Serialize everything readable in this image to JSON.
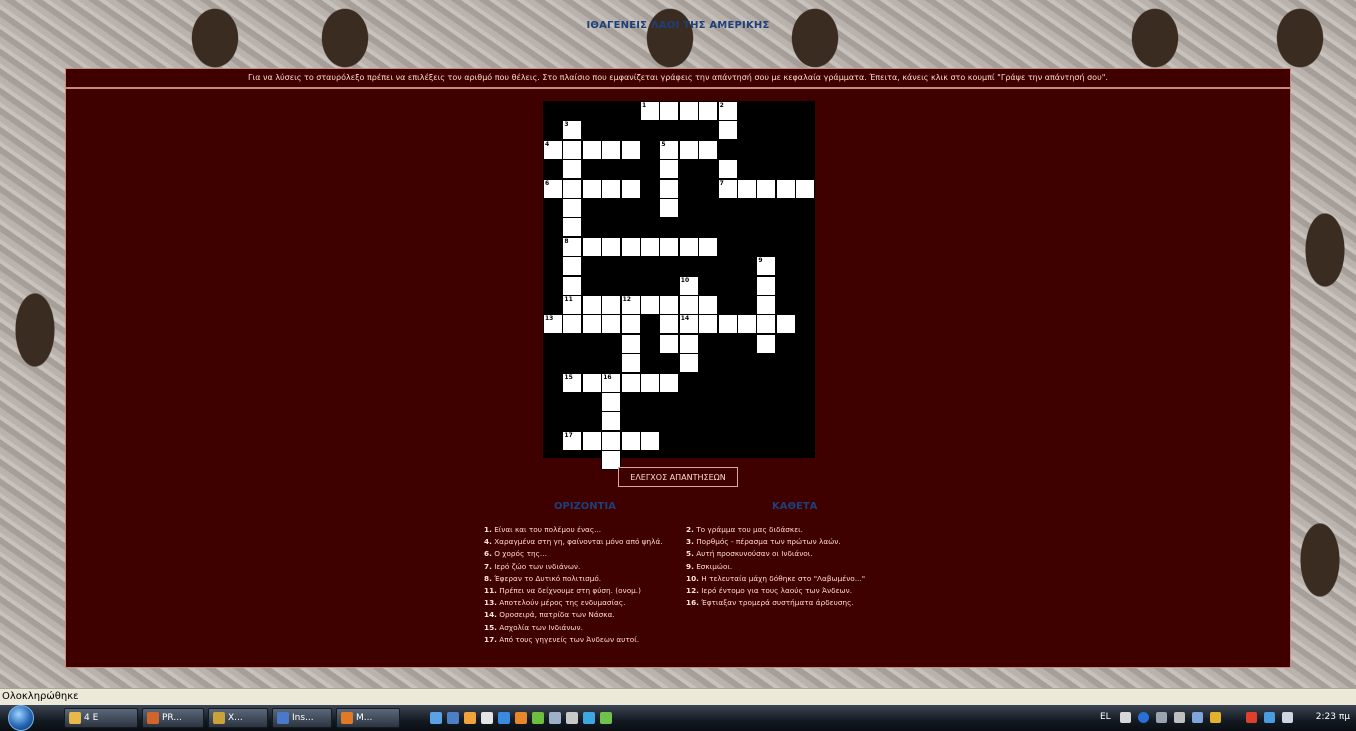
{
  "page": {
    "heading": "ΙΘΑΓΕΝΕΙΣ ΛΑΟΙ ΤΗΣ ΑΜΕΡΙΚΗΣ",
    "instructions": "Για να λύσεις το σταυρόλεξο πρέπει να επιλέξεις τον αριθμό που θέλεις. Στο πλαίσιο που εμφανίζεται γράφεις την απάντησή σου με κεφαλαία γράμματα. Έπειτα, κάνεις κλικ στο κουμπί \"Γράψε την απάντησή σου\".",
    "check_button": "ΕΛΕΓΧΟΣ ΑΠΑΝΤΗΣΕΩΝ"
  },
  "crossword": {
    "cells": [
      [
        5,
        0,
        1
      ],
      [
        6,
        0,
        null
      ],
      [
        7,
        0,
        null
      ],
      [
        8,
        0,
        null
      ],
      [
        9,
        0,
        2
      ],
      [
        1,
        1,
        3
      ],
      [
        9,
        1,
        null
      ],
      [
        0,
        2,
        4
      ],
      [
        1,
        2,
        null
      ],
      [
        2,
        2,
        null
      ],
      [
        3,
        2,
        null
      ],
      [
        4,
        2,
        null
      ],
      [
        6,
        2,
        5
      ],
      [
        7,
        2,
        null
      ],
      [
        8,
        2,
        null
      ],
      [
        1,
        3,
        null
      ],
      [
        6,
        3,
        null
      ],
      [
        9,
        3,
        null
      ],
      [
        0,
        4,
        6
      ],
      [
        1,
        4,
        null
      ],
      [
        2,
        4,
        null
      ],
      [
        3,
        4,
        null
      ],
      [
        4,
        4,
        null
      ],
      [
        6,
        4,
        null
      ],
      [
        9,
        4,
        7
      ],
      [
        10,
        4,
        null
      ],
      [
        11,
        4,
        null
      ],
      [
        12,
        4,
        null
      ],
      [
        13,
        4,
        null
      ],
      [
        1,
        5,
        null
      ],
      [
        6,
        5,
        null
      ],
      [
        1,
        6,
        null
      ],
      [
        1,
        7,
        8
      ],
      [
        2,
        7,
        null
      ],
      [
        3,
        7,
        null
      ],
      [
        4,
        7,
        null
      ],
      [
        5,
        7,
        null
      ],
      [
        6,
        7,
        null
      ],
      [
        7,
        7,
        null
      ],
      [
        8,
        7,
        null
      ],
      [
        1,
        8,
        null
      ],
      [
        11,
        8,
        9
      ],
      [
        1,
        9,
        null
      ],
      [
        7,
        9,
        10
      ],
      [
        11,
        9,
        null
      ],
      [
        1,
        10,
        11
      ],
      [
        2,
        10,
        null
      ],
      [
        3,
        10,
        null
      ],
      [
        4,
        10,
        12
      ],
      [
        5,
        10,
        null
      ],
      [
        6,
        10,
        null
      ],
      [
        7,
        10,
        null
      ],
      [
        8,
        10,
        null
      ],
      [
        11,
        10,
        null
      ],
      [
        0,
        11,
        13
      ],
      [
        1,
        11,
        null
      ],
      [
        2,
        11,
        null
      ],
      [
        3,
        11,
        null
      ],
      [
        4,
        11,
        null
      ],
      [
        6,
        11,
        null
      ],
      [
        7,
        11,
        14
      ],
      [
        8,
        11,
        null
      ],
      [
        9,
        11,
        null
      ],
      [
        10,
        11,
        null
      ],
      [
        11,
        11,
        null
      ],
      [
        12,
        11,
        null
      ],
      [
        4,
        12,
        null
      ],
      [
        6,
        12,
        null
      ],
      [
        7,
        12,
        null
      ],
      [
        11,
        12,
        null
      ],
      [
        4,
        13,
        null
      ],
      [
        7,
        13,
        null
      ],
      [
        1,
        14,
        15
      ],
      [
        2,
        14,
        null
      ],
      [
        3,
        14,
        16
      ],
      [
        4,
        14,
        null
      ],
      [
        5,
        14,
        null
      ],
      [
        6,
        14,
        null
      ],
      [
        3,
        15,
        null
      ],
      [
        3,
        16,
        null
      ],
      [
        1,
        17,
        17
      ],
      [
        2,
        17,
        null
      ],
      [
        3,
        17,
        null
      ],
      [
        4,
        17,
        null
      ],
      [
        5,
        17,
        null
      ],
      [
        3,
        18,
        null
      ]
    ]
  },
  "clues": {
    "across_title": "ΟΡΙΖΟΝΤΙΑ",
    "down_title": "ΚΑΘΕΤΑ",
    "across": [
      {
        "num": "1.",
        "text": "Είναι και του πολέμου ένας..."
      },
      {
        "num": "4.",
        "text": "Χαραγμένα στη γη, φαίνονται μόνο από ψηλά."
      },
      {
        "num": "6.",
        "text": "Ο χορός της..."
      },
      {
        "num": "7.",
        "text": "Ιερό ζώο των ινδιάνων."
      },
      {
        "num": "8.",
        "text": "Έφεραν το Δυτικό πολιτισμό."
      },
      {
        "num": "11.",
        "text": "Πρέπει να δείχνουμε στη φύση. (ονομ.)"
      },
      {
        "num": "13.",
        "text": "Αποτελούν μέρος της ενδυμασίας."
      },
      {
        "num": "14.",
        "text": "Οροσειρά, πατρίδα των Νάσκα."
      },
      {
        "num": "15.",
        "text": "Ασχολία των Ινδιάνων."
      },
      {
        "num": "17.",
        "text": "Από τους γηγενείς των Άνδεων αυτοί."
      }
    ],
    "down": [
      {
        "num": "2.",
        "text": "Το γράμμα του μας διδάσκει."
      },
      {
        "num": "3.",
        "text": "Πορθμός - πέρασμα των πρώτων λαών."
      },
      {
        "num": "5.",
        "text": "Αυτή προσκυνούσαν οι Ινδιάνοι."
      },
      {
        "num": "9.",
        "text": "Εσκιμώοι."
      },
      {
        "num": "10.",
        "text": "Η τελευταία μάχη δόθηκε στο \"Λαβωμένο...\""
      },
      {
        "num": "12.",
        "text": "Ιερό έντομο για τους λαούς των Άνδεων."
      },
      {
        "num": "16.",
        "text": "Έφτιαξαν τρομερά συστήματα άρδευσης."
      }
    ]
  },
  "status_bar": {
    "text": "Ολοκληρώθηκε"
  },
  "taskbar": {
    "buttons": [
      {
        "label": "4 E",
        "name": "explorer-group",
        "color": "#e8b84a"
      },
      {
        "label": "PR...",
        "name": "powerpoint",
        "color": "#d2652b"
      },
      {
        "label": "X...",
        "name": "app-x",
        "color": "#c9a33a"
      },
      {
        "label": "Ins...",
        "name": "instructions-app",
        "color": "#4a79c9"
      },
      {
        "label": "M...",
        "name": "firefox-window",
        "color": "#e07a25"
      }
    ],
    "quick_launch_colors": [
      "#5aa1e6",
      "#4d7fc4",
      "#f0a23b",
      "#e5e5e5",
      "#3a8be0",
      "#e8872a",
      "#6fbf3f",
      "#9fb1c8",
      "#c8c8c8",
      "#3fa7e0",
      "#71c24b"
    ],
    "tray": {
      "language": "EL",
      "clock": "2:23 πμ"
    }
  }
}
